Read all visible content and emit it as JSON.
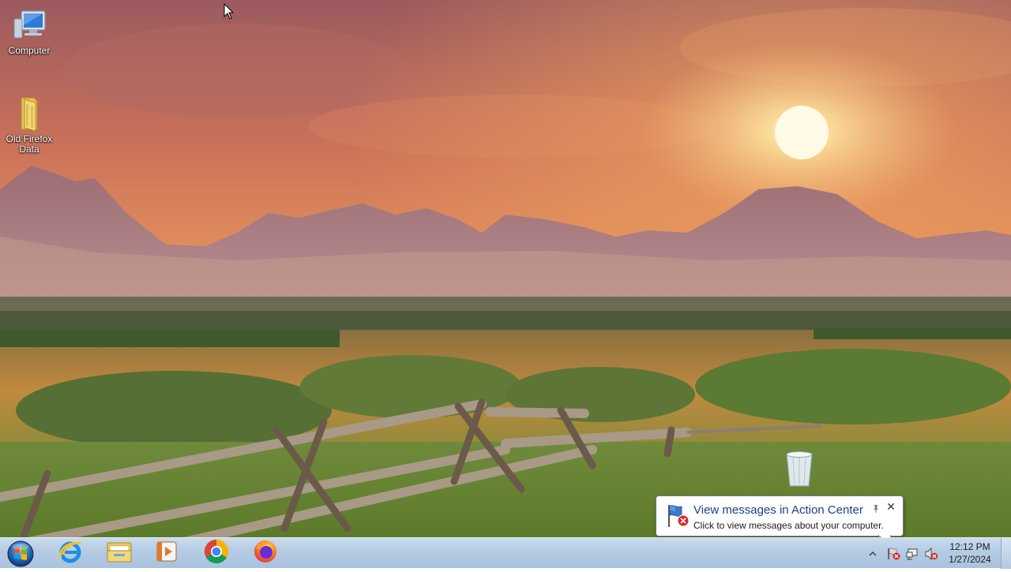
{
  "desktop": {
    "icons": [
      {
        "label": "Computer",
        "icon": "computer-icon"
      },
      {
        "label": "Old Firefox Data",
        "icon": "folder-icon"
      }
    ],
    "recycle_bin_icon": "recycle-bin-icon"
  },
  "taskbar": {
    "start_icon": "windows-start-icon",
    "pinned": [
      {
        "name": "internet-explorer",
        "icon": "ie-icon"
      },
      {
        "name": "file-explorer",
        "icon": "folder-icon"
      },
      {
        "name": "media-player",
        "icon": "media-player-icon"
      },
      {
        "name": "chrome",
        "icon": "chrome-icon"
      },
      {
        "name": "firefox",
        "icon": "firefox-icon"
      }
    ],
    "tray": {
      "time": "12:12 PM",
      "date": "1/27/2024"
    }
  },
  "notification": {
    "title": "View messages in Action Center",
    "message": "Click to view messages about your computer.",
    "close_glyph": "✕"
  },
  "colors": {
    "taskbar_top": "#c9dcee",
    "taskbar_bottom": "#a9c2dc",
    "balloon_title": "#1a3f8f"
  }
}
